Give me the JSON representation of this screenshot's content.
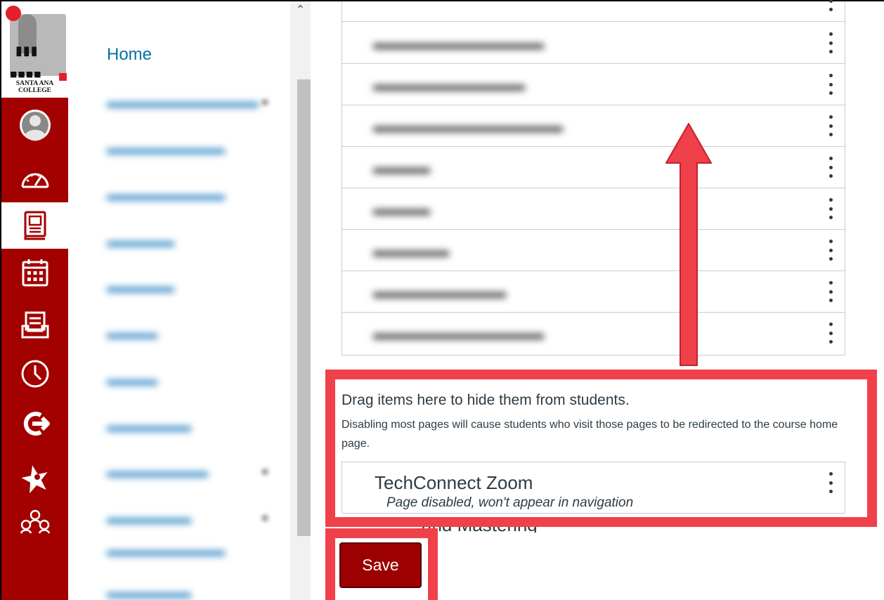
{
  "logo": {
    "text_line1": "SANTA ANA",
    "text_line2": "COLLEGE"
  },
  "global_nav": {
    "items": [
      {
        "name": "account",
        "icon": "user-avatar-icon",
        "active": false
      },
      {
        "name": "dashboard",
        "icon": "dashboard-gauge-icon",
        "active": false
      },
      {
        "name": "courses",
        "icon": "book-icon",
        "active": true
      },
      {
        "name": "calendar",
        "icon": "calendar-icon",
        "active": false
      },
      {
        "name": "inbox",
        "icon": "inbox-icon",
        "active": false
      },
      {
        "name": "history",
        "icon": "clock-icon",
        "active": false
      },
      {
        "name": "commons",
        "icon": "commons-arrow-icon",
        "active": false
      },
      {
        "name": "starfish",
        "icon": "star-icon",
        "active": false
      },
      {
        "name": "studio",
        "icon": "people-network-icon",
        "active": false
      }
    ],
    "active_bg": "#ffffff",
    "bg_color": "#a30000"
  },
  "course_nav": {
    "home_label": "Home"
  },
  "drop_zone": {
    "title": "Drag items here to hide them from students.",
    "description": "Disabling most pages will cause students who visit those pages to be redirected to the course home page.",
    "item_name": "TechConnect Zoom",
    "item_status": "Page disabled, won't appear in navigation",
    "partial_below": "and Mastering"
  },
  "save_button": {
    "label": "Save",
    "color": "#9c0000"
  },
  "highlight_color": "#f0414a"
}
